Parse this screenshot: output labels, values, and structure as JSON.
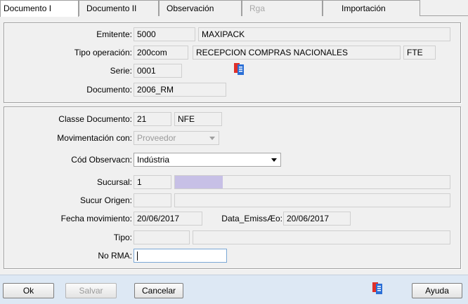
{
  "tabs": [
    {
      "label": "Documento I",
      "state": "active"
    },
    {
      "label": "Documento II",
      "state": "normal"
    },
    {
      "label": "Observación",
      "state": "normal"
    },
    {
      "label": "Rga",
      "state": "disabled"
    },
    {
      "label": "Importación",
      "state": "normal"
    }
  ],
  "top": {
    "emitente": {
      "label": "Emitente:",
      "code": "5000",
      "name": "MAXIPACK"
    },
    "tipo_operacion": {
      "label": "Tipo operación:",
      "code": "200com",
      "desc": "RECEPCION COMPRAS NACIONALES",
      "extra": "FTE"
    },
    "serie": {
      "label": "Serie:",
      "value": "0001"
    },
    "documento": {
      "label": "Documento:",
      "value": "2006_RM"
    }
  },
  "bottom": {
    "classe_documento": {
      "label": "Classe Documento:",
      "code": "21",
      "value": "NFE"
    },
    "movimentacion_con": {
      "label": "Movimentación con:",
      "value": "Proveedor"
    },
    "cod_observacn": {
      "label": "Cód Observacn:",
      "value": "Indústria"
    },
    "sucursal": {
      "label": "Sucursal:",
      "code": "1",
      "name": ""
    },
    "sucur_origen": {
      "label": "Sucur Origen:",
      "code": "",
      "name": ""
    },
    "fecha_movimiento": {
      "label": "Fecha movimiento:",
      "value": "20/06/2017"
    },
    "data_emissao": {
      "label": "Data_EmissÆo:",
      "value": "20/06/2017"
    },
    "tipo": {
      "label": "Tipo:",
      "code": "",
      "name": ""
    },
    "no_rma": {
      "label": "No RMA:",
      "value": ""
    }
  },
  "buttons": {
    "ok": "Ok",
    "salvar": "Salvar",
    "cancelar": "Cancelar",
    "ayuda": "Ayuda"
  },
  "colors": {
    "accent": "#c7c0e6",
    "bottom_bar": "#dde8f4",
    "icon_red": "#e0302a",
    "icon_blue": "#2b6fd6"
  },
  "icons": {
    "docs": "documents-icon"
  }
}
